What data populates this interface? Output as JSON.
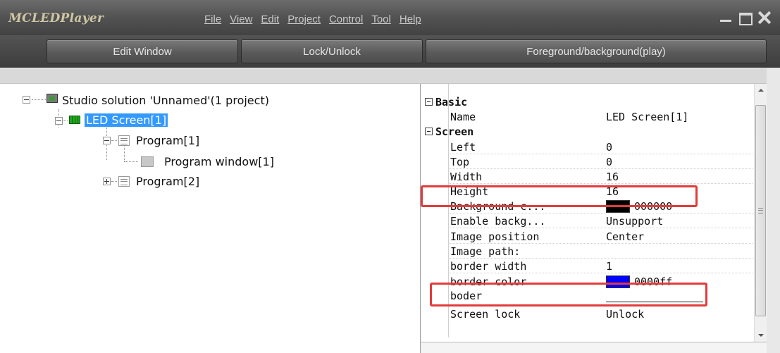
{
  "app": {
    "title": "MCLEDPlayer"
  },
  "menu": [
    "File",
    "View",
    "Edit",
    "Project",
    "Control",
    "Tool",
    "Help"
  ],
  "toolbar": {
    "edit_window": "Edit Window",
    "lock_unlock": "Lock/Unlock",
    "foreground_background": "Foreground/background(play)"
  },
  "tree": {
    "solution": "Studio solution 'Unnamed'(1 project)",
    "led_screen": "LED Screen[1]",
    "program1": "Program[1]",
    "program_window1": "Program window[1]",
    "program2": "Program[2]"
  },
  "properties": {
    "basic_category": "Basic",
    "name_label": "Name",
    "name_value": "LED Screen[1]",
    "screen_category": "Screen",
    "left_label": "Left",
    "left_value": "0",
    "top_label": "Top",
    "top_value": "0",
    "width_label": "Width",
    "width_value": "16",
    "height_label": "Height",
    "height_value": "16",
    "bg_color_label": "Background c...",
    "bg_color_value": "000000",
    "enable_bg_label": "Enable backg...",
    "enable_bg_value": "Unsupport",
    "image_position_label": "Image position",
    "image_position_value": "Center",
    "image_path_label": "Image path:",
    "border_width_label": "border width",
    "border_width_value": "1",
    "border_color_label": "border color",
    "border_color_value": "0000ff",
    "boder_label": "boder",
    "screen_lock_label": "Screen lock",
    "screen_lock_value": "Unlock"
  },
  "colors": {
    "background_swatch": "#000000",
    "border_swatch": "#0000ff",
    "highlight": "#e23b3b",
    "selection": "#3399ff"
  }
}
